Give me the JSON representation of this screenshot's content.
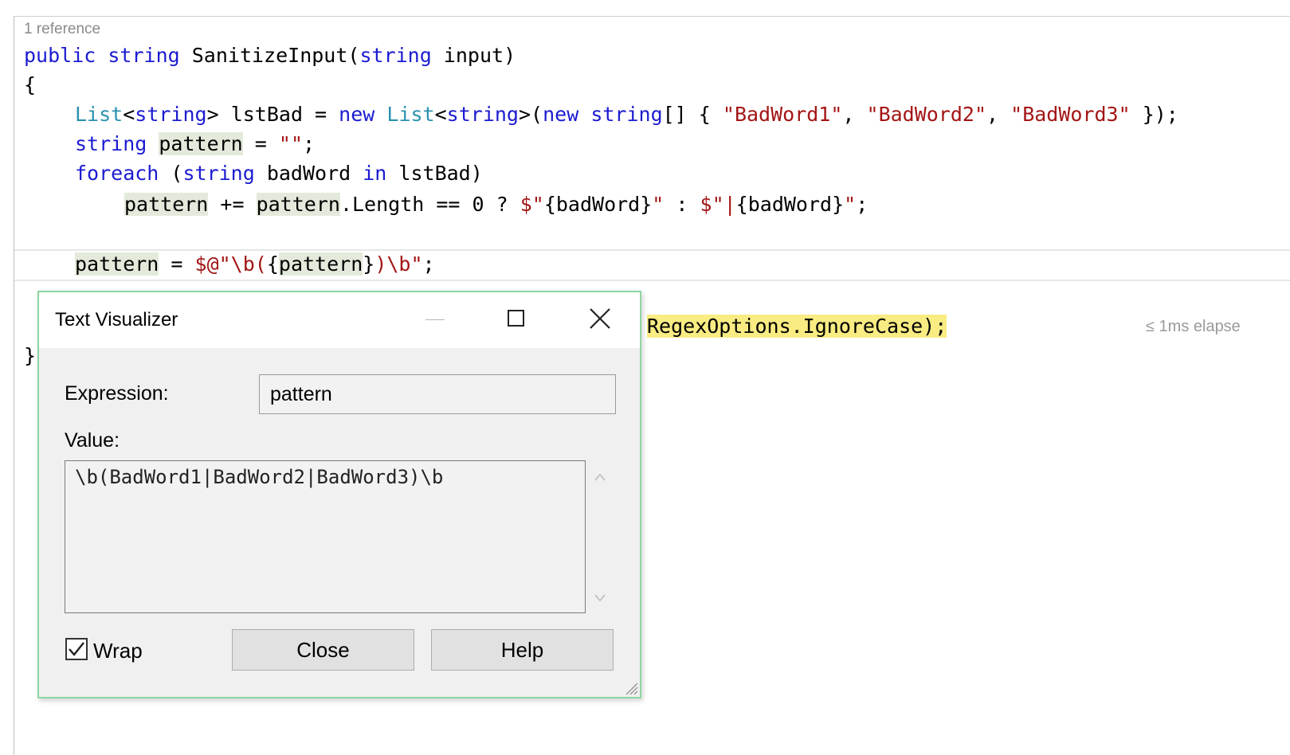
{
  "editor": {
    "codelens": "1 reference",
    "lines": {
      "sig_kw1": "public",
      "sig_kw2": "string",
      "sig_name": " SanitizeInput(",
      "sig_kw3": "string",
      "sig_rest": " input)",
      "open_brace": "{",
      "l3_list": "List",
      "l3_a": "<",
      "l3_string1": "string",
      "l3_b": "> lstBad = ",
      "l3_new1": "new",
      "l3_sp": " ",
      "l3_list2": "List",
      "l3_c": "<",
      "l3_string2": "string",
      "l3_d": ">(",
      "l3_new2": "new",
      "l3_e": " ",
      "l3_string3": "string",
      "l3_f": "[] { ",
      "l3_s1": "\"BadWord1\"",
      "l3_g": ", ",
      "l3_s2": "\"BadWord2\"",
      "l3_h": ", ",
      "l3_s3": "\"BadWord3\"",
      "l3_i": " });",
      "l4_string": "string",
      "l4_sp": " ",
      "l4_pattern": "pattern",
      "l4_eq": " = ",
      "l4_str": "\"\"",
      "l4_end": ";",
      "l5_foreach": "foreach",
      "l5_a": " (",
      "l5_string": "string",
      "l5_b": " badWord ",
      "l5_in": "in",
      "l5_c": " lstBad)",
      "l6_pattern1": "pattern",
      "l6_a": " += ",
      "l6_pattern2": "pattern",
      "l6_b": ".Length == 0 ? ",
      "l6_s1": "$\"",
      "l6_c": "{badWord}",
      "l6_s2": "\"",
      "l6_d": " : ",
      "l6_s3": "$\"|",
      "l6_e": "{badWord}",
      "l6_s4": "\"",
      "l6_f": ";",
      "l8_pattern": "pattern",
      "l8_a": " = ",
      "l8_s1": "$@\"\\b(",
      "l8_b": "{",
      "l8_pattern2": "pattern",
      "l8_c": "}",
      "l8_s2": ")\\b\"",
      "l8_d": ";",
      "l9_visible": "RegexOptions.IgnoreCase);",
      "close_brace": "}"
    },
    "elapsed": "≤ 1ms elapse"
  },
  "dialog": {
    "title": "Text Visualizer",
    "expression_label": "Expression:",
    "expression_value": "pattern",
    "value_label": "Value:",
    "value_text": "\\b(BadWord1|BadWord2|BadWord3)\\b",
    "wrap_label": "Wrap",
    "wrap_checked": true,
    "close_button": "Close",
    "help_button": "Help",
    "icons": [
      "minimize-icon",
      "maximize-icon",
      "close-icon",
      "scroll-up-icon",
      "scroll-down-icon",
      "resize-grip-icon",
      "checkmark-icon"
    ],
    "border_color": "#8fd6a3"
  }
}
